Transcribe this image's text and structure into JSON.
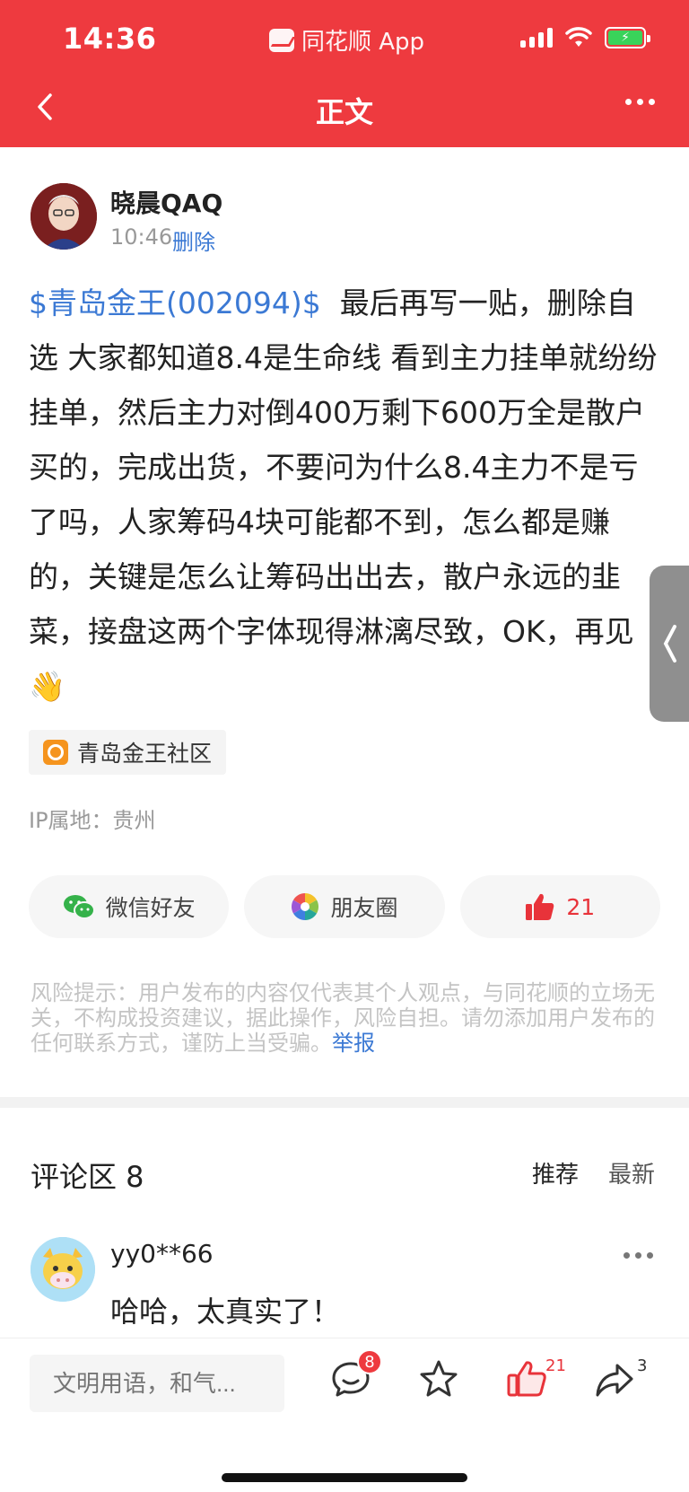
{
  "status_bar": {
    "time": "14:36",
    "app_label": "同花顺 App"
  },
  "nav": {
    "title": "正文"
  },
  "post": {
    "author": "晓晨QAQ",
    "time": "10:46",
    "delete_label": "删除",
    "stock_tag": "$青岛金王(002094)$",
    "content": "最后再写一贴，删除自选 大家都知道8.4是生命线 看到主力挂单就纷纷挂单，然后主力对倒400万剩下600万全是散户买的，完成出货，不要问为什么8.4主力不是亏了吗，人家筹码4块可能都不到，怎么都是赚的，关键是怎么让筹码出出去，散户永远的韭菜，接盘这两个字体现得淋漓尽致，OK，再见",
    "emoji": "👋",
    "community": "青岛金王社区",
    "ip_location": "IP属地：贵州"
  },
  "share": {
    "wechat_label": "微信好友",
    "moments_label": "朋友圈",
    "like_count": "21"
  },
  "risk_notice": {
    "text": "风险提示：用户发布的内容仅代表其个人观点，与同花顺的立场无关，不构成投资建议，据此操作，风险自担。请勿添加用户发布的任何联系方式，谨防上当受骗。",
    "report_label": "举报"
  },
  "comments": {
    "title": "评论区 8",
    "sort_recommended": "推荐",
    "sort_latest": "最新",
    "items": [
      {
        "user": "yy0**66",
        "text": "哈哈，太真实了！"
      }
    ]
  },
  "bottom_bar": {
    "input_placeholder": "文明用语，和气...",
    "comment_badge": "8",
    "like_count": "21",
    "share_count": "3"
  },
  "colors": {
    "brand_red": "#ee3a3f",
    "link_blue": "#3b79d4",
    "like_red": "#e8333a"
  }
}
